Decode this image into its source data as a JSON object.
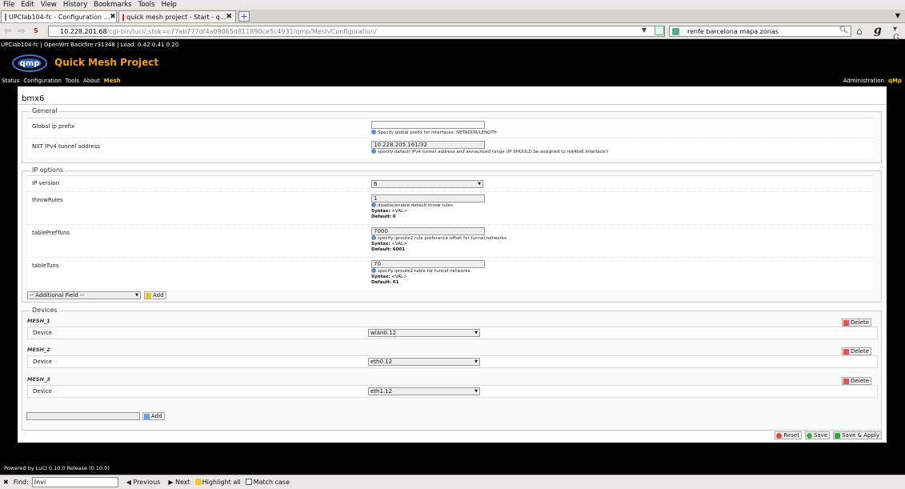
{
  "browser": {
    "menu": [
      "File",
      "Edit",
      "View",
      "History",
      "Bookmarks",
      "Tools",
      "Help"
    ],
    "tabs": [
      {
        "title": "UPClab104-fc - Configuration ..."
      },
      {
        "title": "quick mesh project - Start - q..."
      }
    ],
    "url_host": "10.228.201.68",
    "url_rest": "/cgi-bin/luci/;stok=c77ab777df4a09065d811890ce5c4931/qmp/Mesh/Configuration/",
    "search_text": "renfe barcelona mapa zonas"
  },
  "page": {
    "status_line": "UPClab104-fc | OpenWrt Backfire r31348 | Load: 0.42 0.41 0.20",
    "logo_text": "qmp",
    "brand": "Quick Mesh Project",
    "menu": [
      "Status",
      "Configuration",
      "Tools",
      "About",
      "Mesh"
    ],
    "right_menu": [
      "Administration",
      "qMp"
    ],
    "title": "bmx6"
  },
  "general": {
    "legend": "General",
    "fields": [
      {
        "label": "Global ip prefix",
        "value": "",
        "help": "Specify global prefix for interfaces: NETADDR/LENGTH"
      },
      {
        "label": "NIIT IPv4 tunnel address",
        "value": "10.228.205.161/32",
        "help": "specify default IPv4 tunnel address and announced range (IP SHOULD be assigned to niit4to6 interface!)"
      }
    ]
  },
  "ip_options": {
    "legend": "IP options",
    "ip_version": {
      "label": "IP version",
      "value": "6"
    },
    "fields": [
      {
        "label": "throwRules",
        "value": "1",
        "help": "disable/enable default throw rules",
        "syntax_label": "Syntax:",
        "syntax": "<VAL>",
        "default_label": "Default:",
        "default": "0"
      },
      {
        "label": "tablePrefTuns",
        "value": "7000",
        "help": "specify iproute2 rule preference offset for tunnel networks",
        "syntax_label": "Syntax:",
        "syntax": "<VAL>",
        "default_label": "Default:",
        "default": "6001"
      },
      {
        "label": "tableTuns",
        "value": "70",
        "help": "specify iproute2 table for tunnel networks",
        "syntax_label": "Syntax:",
        "syntax": "<VAL>",
        "default_label": "Default:",
        "default": "61"
      }
    ],
    "additional_field": "-- Additional Field --",
    "add_label": "Add"
  },
  "devices": {
    "legend": "Devices",
    "items": [
      {
        "name": "MESH_1",
        "label": "Device",
        "value": "wlan0.12"
      },
      {
        "name": "MESH_2",
        "label": "Device",
        "value": "eth0.12"
      },
      {
        "name": "MESH_3",
        "label": "Device",
        "value": "eth1.12"
      }
    ],
    "delete_label": "Delete",
    "add_label": "Add"
  },
  "actions": {
    "reset": "Reset",
    "save": "Save",
    "save_apply": "Save & Apply"
  },
  "footer": "Powered by LuCI 0.10.0 Release (0.10.0)",
  "findbar": {
    "label": "Find:",
    "value": "Invi",
    "previous": "Previous",
    "next": "Next",
    "highlight": "Highlight all",
    "match_case": "Match case"
  }
}
